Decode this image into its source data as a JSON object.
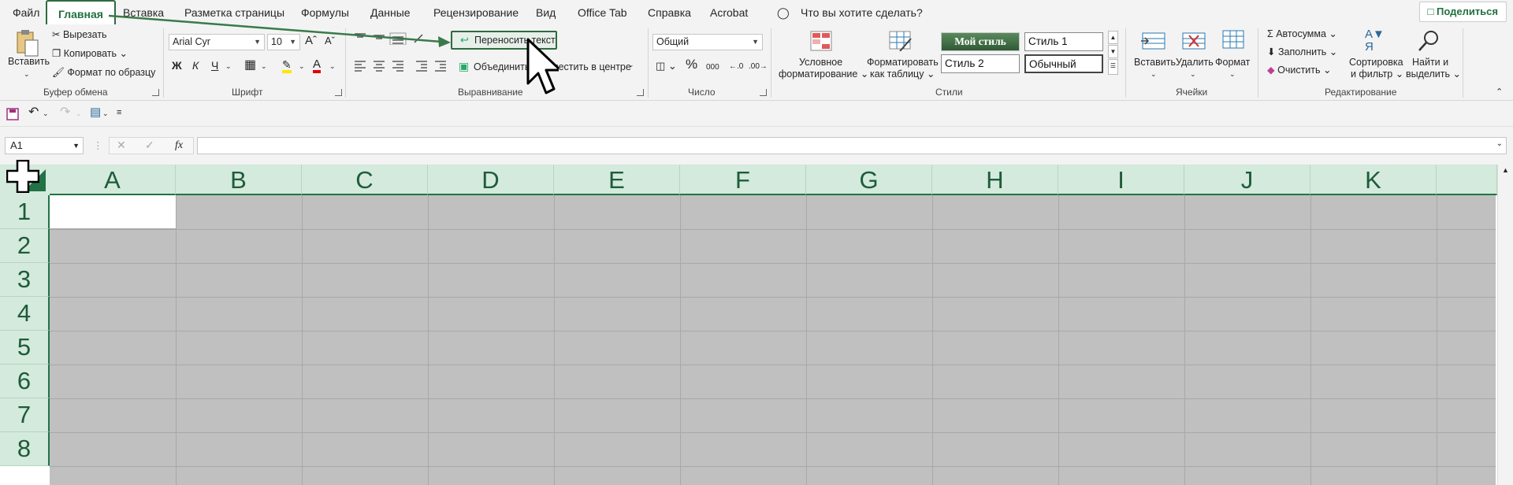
{
  "menu": {
    "tabs": [
      "Файл",
      "Главная",
      "Вставка",
      "Разметка страницы",
      "Формулы",
      "Данные",
      "Рецензирование",
      "Вид",
      "Office Tab",
      "Справка",
      "Acrobat"
    ],
    "tell_me": "Что вы хотите сделать?",
    "share": "Поделиться"
  },
  "clipboard": {
    "paste": "Вставить",
    "cut": "Вырезать",
    "copy": "Копировать",
    "format_painter": "Формат по образцу",
    "label": "Буфер обмена"
  },
  "font": {
    "name": "Arial Cyr",
    "size": "10",
    "bold": "Ж",
    "italic": "К",
    "underline": "Ч",
    "label": "Шрифт"
  },
  "alignment": {
    "wrap_text": "Переносить текст",
    "merge": "Объединить и поместить в центре",
    "label": "Выравнивание"
  },
  "number": {
    "format": "Общий",
    "label": "Число"
  },
  "styles": {
    "conditional": [
      "Условное",
      "форматирование"
    ],
    "as_table": [
      "Форматировать",
      "как таблицу"
    ],
    "my_style": "Мой стиль",
    "style1": "Стиль 1",
    "style2": "Стиль 2",
    "normal": "Обычный",
    "label": "Стили"
  },
  "cells": {
    "insert": "Вставить",
    "delete": "Удалить",
    "format": "Формат",
    "label": "Ячейки"
  },
  "editing": {
    "autosum": "Автосумма",
    "fill": "Заполнить",
    "clear": "Очистить",
    "sort": [
      "Сортировка",
      "и фильтр"
    ],
    "find": [
      "Найти и",
      "выделить"
    ],
    "label": "Редактирование"
  },
  "formula_bar": {
    "name_box": "A1",
    "fx": "fx",
    "value": ""
  },
  "grid": {
    "columns": [
      "A",
      "B",
      "C",
      "D",
      "E",
      "F",
      "G",
      "H",
      "I",
      "J",
      "K"
    ],
    "rows": [
      "1",
      "2",
      "3",
      "4",
      "5",
      "6",
      "7",
      "8"
    ],
    "selected_cell": "A1"
  },
  "colors": {
    "accent": "#217346",
    "header_bg": "#d3eadc",
    "selection_fill": "#c0c0c0",
    "arrow": "#3a7a4a"
  }
}
